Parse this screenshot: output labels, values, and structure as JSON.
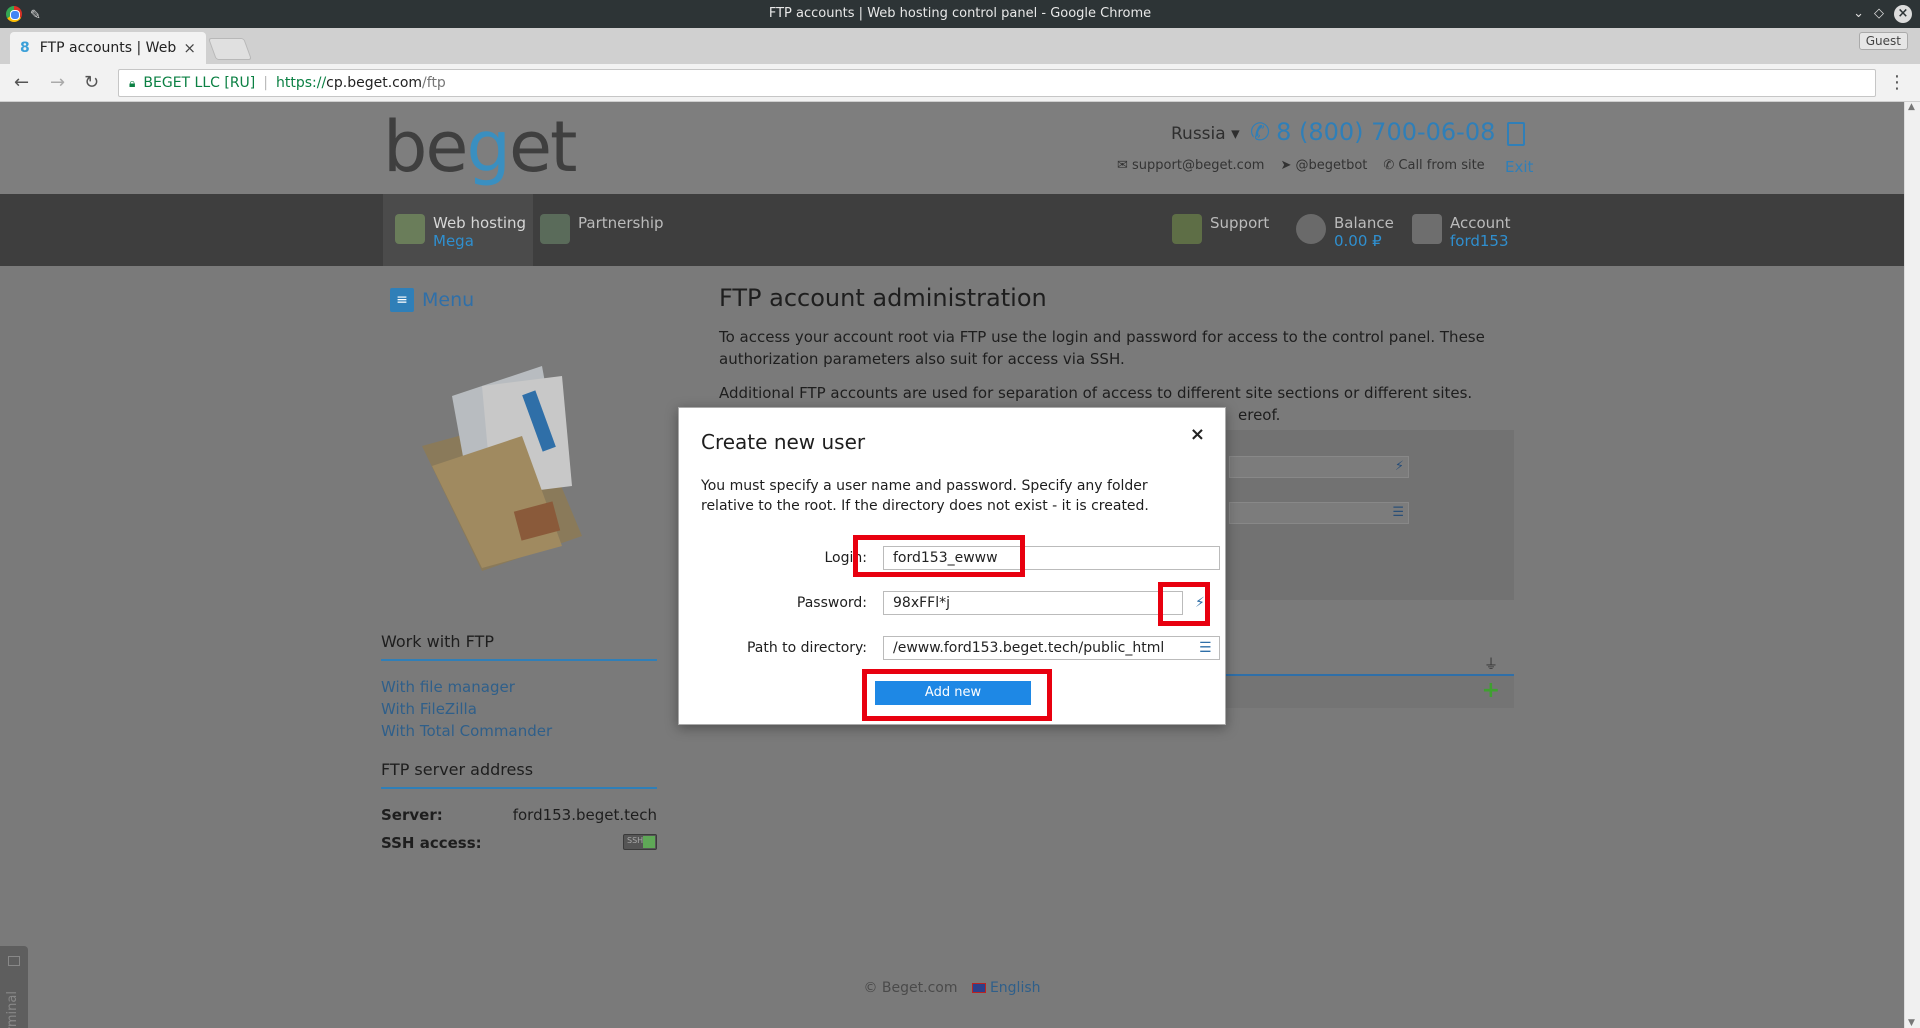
{
  "window": {
    "title": "FTP accounts | Web hosting control panel - Google Chrome",
    "guest_label": "Guest"
  },
  "tab": {
    "title": "FTP accounts | Web",
    "favicon": "8"
  },
  "address": {
    "org": "BEGET LLC [RU]",
    "scheme": "https://",
    "host": "cp.beget.com",
    "path": "/ftp"
  },
  "header": {
    "logo_pre": "be",
    "logo_g": "g",
    "logo_post": "et",
    "region": "Russia ▾",
    "phone": "8 (800) 700-06-08",
    "email": "support@beget.com",
    "telegram": "@begetbot",
    "call": "Call from site",
    "exit": "Exit"
  },
  "nav": {
    "webhosting": {
      "label": "Web hosting",
      "sub": "Mega"
    },
    "partnership": {
      "label": "Partnership"
    },
    "support": {
      "label": "Support"
    },
    "balance": {
      "label": "Balance",
      "sub": "0.00 ₽"
    },
    "account": {
      "label": "Account",
      "sub": "ford153"
    }
  },
  "sidebar": {
    "menu_label": "Menu",
    "work_title": "Work with FTP",
    "links": [
      "With file manager",
      "With FileZilla",
      "With Total Commander"
    ],
    "server_title": "FTP server address",
    "server_key": "Server:",
    "server_value": "ford153.beget.tech",
    "ssh_key": "SSH access:",
    "ssh_badge": "SSH"
  },
  "main": {
    "title": "FTP account administration",
    "para1": "To access your account root via FTP use the login and password for access to the control panel. These authorization parameters also suit for access via SSH.",
    "para2_line1": "Additional FTP accounts are used for separation of access to different site sections or different sites. Created",
    "para2_line2_tail": "ereof."
  },
  "footer": {
    "copyright": "© Beget.com",
    "language": "English"
  },
  "terminal": {
    "label": "Terminal"
  },
  "modal": {
    "title": "Create new user",
    "close": "×",
    "description": "You must specify a user name and password. Specify any folder relative to the root. If the directory does not exist - it is created.",
    "login_label": "Login:",
    "login_value": "ford153_ewww",
    "password_label": "Password:",
    "password_value": "98xFFl*j",
    "path_label": "Path to directory:",
    "path_value": "/ewww.ford153.beget.tech/public_html",
    "submit": "Add new"
  },
  "icons": {
    "generate_password": "magic-wand-icon",
    "browse_directory": "list-icon",
    "accent": "#1e88e5",
    "highlight": "#e8000f"
  }
}
